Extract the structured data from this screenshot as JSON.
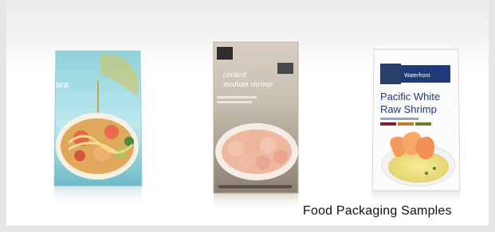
{
  "caption": "Food Packaging Samples",
  "products": [
    {
      "name": "seafood-pasta-pouch",
      "visible_text": [
        "...ara"
      ]
    },
    {
      "name": "cooked-shrimp-pouch",
      "visible_text": [
        "cooked",
        "medium shrimp"
      ]
    },
    {
      "name": "pacific-white-shrimp-pouch",
      "brand": "Waterfront",
      "title_line1": "Pacific White",
      "title_line2": "Raw Shrimp"
    }
  ]
}
